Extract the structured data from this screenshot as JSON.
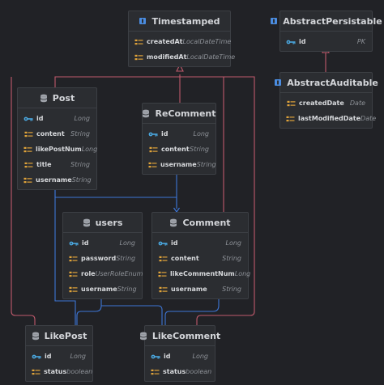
{
  "colors": {
    "inherit": "#c05a6c",
    "assoc": "#3d76d6"
  },
  "entities": {
    "timestamped": {
      "name": "Timestamped",
      "icon": "interface-icon",
      "rows": [
        {
          "name": "createdAt",
          "type": "LocalDateTime",
          "icon": "field-icon"
        },
        {
          "name": "modifiedAt",
          "type": "LocalDateTime",
          "icon": "field-icon"
        }
      ]
    },
    "abstract_persistable": {
      "name": "AbstractPersistable",
      "icon": "interface-icon",
      "rows": [
        {
          "name": "id",
          "type": "PK",
          "icon": "key-icon"
        }
      ]
    },
    "abstract_auditable": {
      "name": "AbstractAuditable",
      "icon": "interface-icon",
      "rows": [
        {
          "name": "createdDate",
          "type": "Date",
          "icon": "field-icon"
        },
        {
          "name": "lastModifiedDate",
          "type": "Date",
          "icon": "field-icon"
        }
      ]
    },
    "post": {
      "name": "Post",
      "icon": "table-icon",
      "rows": [
        {
          "name": "id",
          "type": "Long",
          "icon": "key-icon"
        },
        {
          "name": "content",
          "type": "String",
          "icon": "field-icon"
        },
        {
          "name": "likePostNum",
          "type": "Long",
          "icon": "field-icon"
        },
        {
          "name": "title",
          "type": "String",
          "icon": "field-icon"
        },
        {
          "name": "username",
          "type": "String",
          "icon": "field-icon"
        }
      ]
    },
    "recomment": {
      "name": "ReComment",
      "icon": "table-icon",
      "rows": [
        {
          "name": "id",
          "type": "Long",
          "icon": "key-icon"
        },
        {
          "name": "content",
          "type": "String",
          "icon": "field-icon"
        },
        {
          "name": "username",
          "type": "String",
          "icon": "field-icon"
        }
      ]
    },
    "users": {
      "name": "users",
      "icon": "table-icon",
      "rows": [
        {
          "name": "id",
          "type": "Long",
          "icon": "key-icon"
        },
        {
          "name": "password",
          "type": "String",
          "icon": "field-icon"
        },
        {
          "name": "role",
          "type": "UserRoleEnum",
          "icon": "field-icon"
        },
        {
          "name": "username",
          "type": "String",
          "icon": "field-icon"
        }
      ]
    },
    "comment": {
      "name": "Comment",
      "icon": "table-icon",
      "rows": [
        {
          "name": "id",
          "type": "Long",
          "icon": "key-icon"
        },
        {
          "name": "content",
          "type": "String",
          "icon": "field-icon"
        },
        {
          "name": "likeCommentNum",
          "type": "Long",
          "icon": "field-icon"
        },
        {
          "name": "username",
          "type": "String",
          "icon": "field-icon"
        }
      ]
    },
    "likepost": {
      "name": "LikePost",
      "icon": "table-icon",
      "rows": [
        {
          "name": "id",
          "type": "Long",
          "icon": "key-icon"
        },
        {
          "name": "status",
          "type": "boolean",
          "icon": "field-icon"
        }
      ]
    },
    "likecomment": {
      "name": "LikeComment",
      "icon": "table-icon",
      "rows": [
        {
          "name": "id",
          "type": "Long",
          "icon": "key-icon"
        },
        {
          "name": "status",
          "type": "boolean",
          "icon": "field-icon"
        }
      ]
    }
  }
}
